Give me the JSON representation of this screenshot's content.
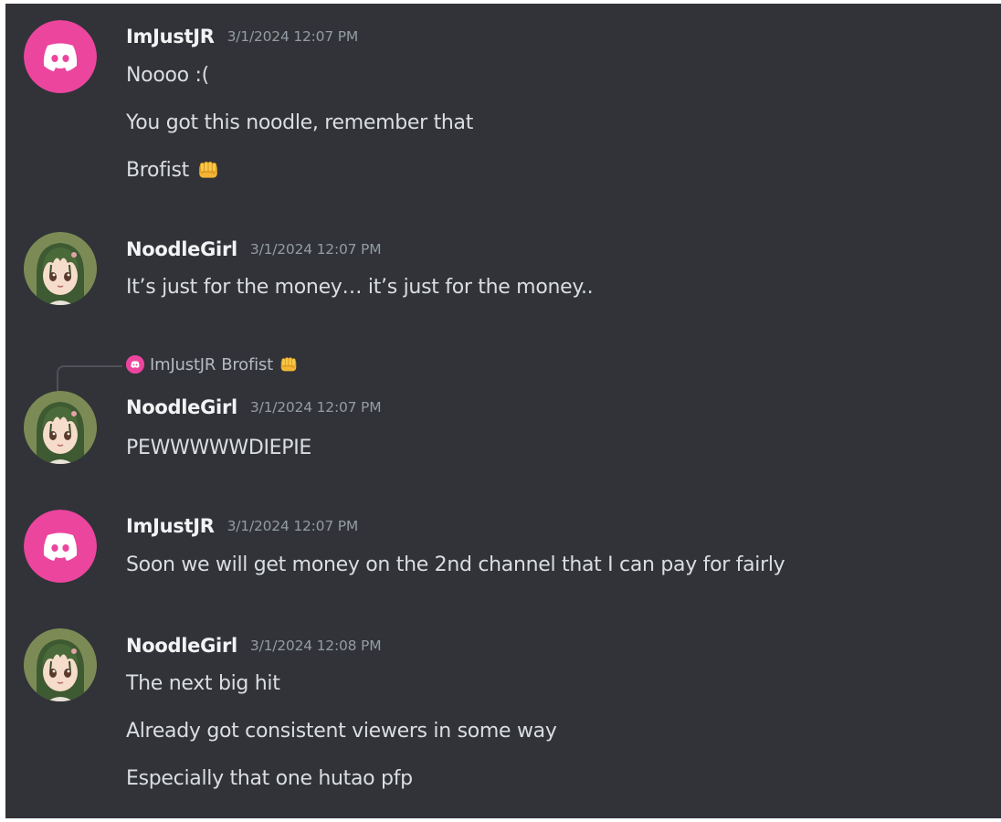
{
  "messages": [
    {
      "author": "ImJustJR",
      "avatar": "discord-logo-icon",
      "timestamp": "3/1/2024 12:07 PM",
      "lines": [
        "Noooo :(",
        "You got this noodle, remember that",
        "Brofist"
      ]
    },
    {
      "author": "NoodleGirl",
      "avatar": "anime-girl-avatar",
      "timestamp": "3/1/2024 12:07 PM",
      "lines": [
        "It’s just for the money… it’s just for the money.."
      ]
    },
    {
      "author": "NoodleGirl",
      "avatar": "anime-girl-avatar",
      "timestamp": "3/1/2024 12:07 PM",
      "reply": {
        "author": "ImJustJR",
        "text": "Brofist"
      },
      "lines": [
        "PEWWWWWDIEPIE"
      ]
    },
    {
      "author": "ImJustJR",
      "avatar": "discord-logo-icon",
      "timestamp": "3/1/2024 12:07 PM",
      "lines": [
        "Soon we will get money on the 2nd channel that I can pay for fairly"
      ]
    },
    {
      "author": "NoodleGirl",
      "avatar": "anime-girl-avatar",
      "timestamp": "3/1/2024 12:08 PM",
      "lines": [
        "The next big hit",
        "Already got consistent viewers in some way",
        "Especially that one hutao pfp"
      ]
    }
  ],
  "colors": {
    "background": "#313338",
    "discord_avatar": "#eb459e",
    "username": "#f2f3f5",
    "message_text": "#dbdee1",
    "timestamp": "#949ba4"
  }
}
